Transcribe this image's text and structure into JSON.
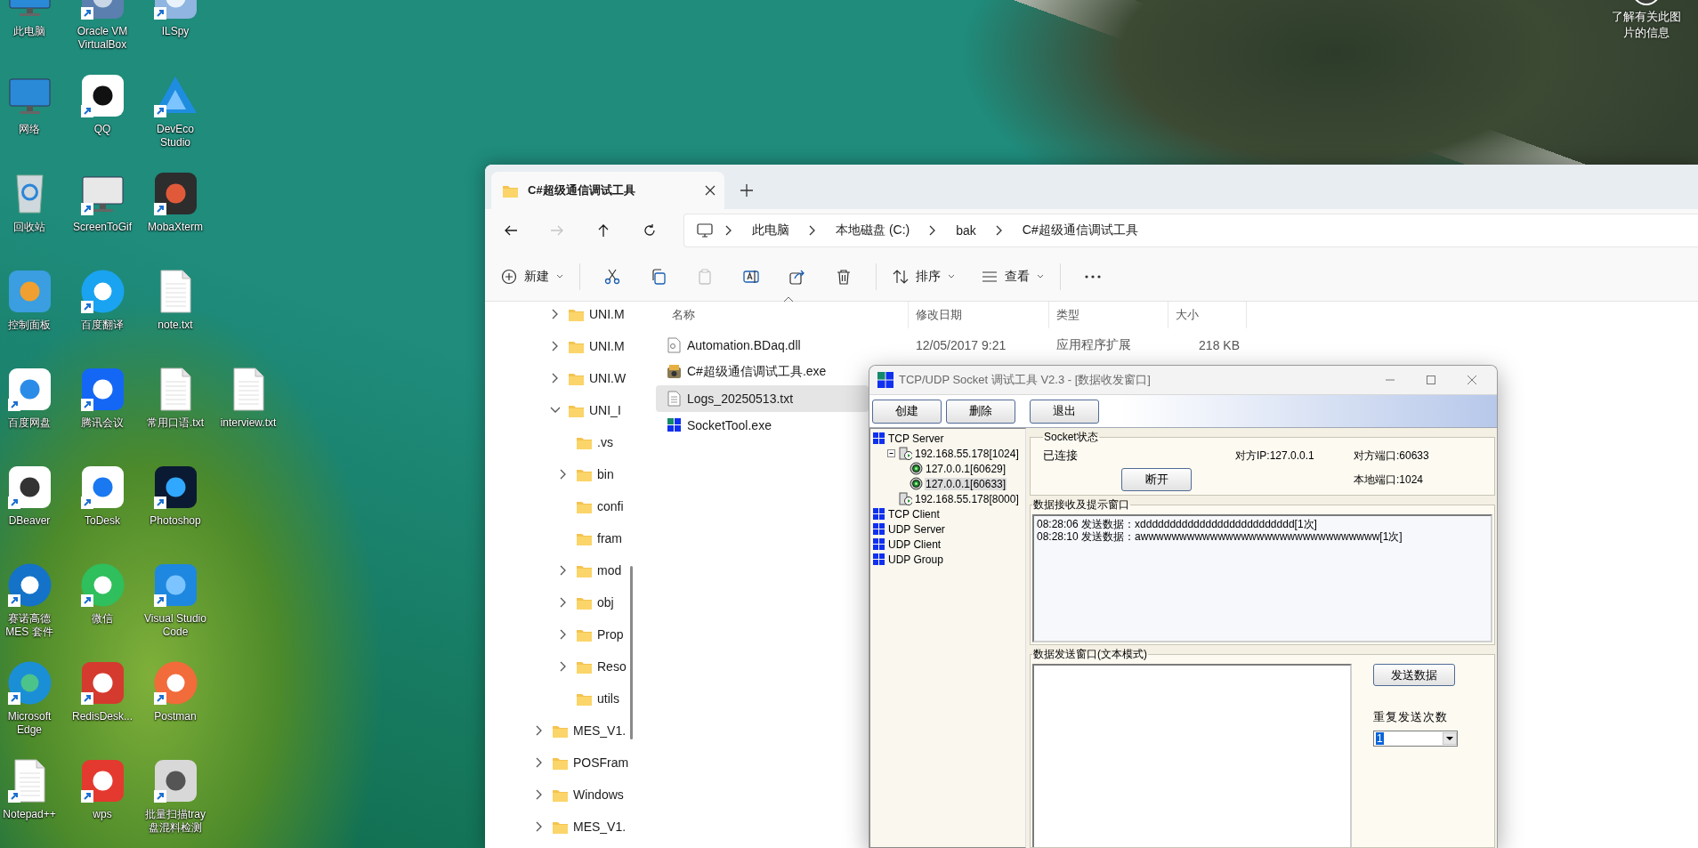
{
  "desktop": {
    "icon_rows": [
      [
        {
          "label": "此电脑",
          "shortcut": false
        },
        {
          "label": "Oracle VM VirtualBox",
          "shortcut": true
        },
        {
          "label": "ILSpy",
          "shortcut": true
        }
      ],
      [
        {
          "label": "网络",
          "shortcut": false
        },
        {
          "label": "QQ",
          "shortcut": true
        },
        {
          "label": "DevEco Studio",
          "shortcut": true
        }
      ],
      [
        {
          "label": "回收站",
          "shortcut": false
        },
        {
          "label": "ScreenToGif",
          "shortcut": true
        },
        {
          "label": "MobaXterm",
          "shortcut": true
        }
      ],
      [
        {
          "label": "控制面板",
          "shortcut": false
        },
        {
          "label": "百度翻译",
          "shortcut": true
        },
        {
          "label": "note.txt",
          "shortcut": false
        }
      ],
      [
        {
          "label": "百度网盘",
          "shortcut": true
        },
        {
          "label": "腾讯会议",
          "shortcut": true
        },
        {
          "label": "常用口语.txt",
          "shortcut": false
        },
        {
          "label": "interview.txt",
          "shortcut": false
        }
      ],
      [
        {
          "label": "DBeaver",
          "shortcut": true
        },
        {
          "label": "ToDesk",
          "shortcut": true
        },
        {
          "label": "Photoshop",
          "shortcut": true
        }
      ],
      [
        {
          "label": "赛诺高德 MES 套件",
          "shortcut": true
        },
        {
          "label": "微信",
          "shortcut": true
        },
        {
          "label": "Visual Studio Code",
          "shortcut": true
        }
      ],
      [
        {
          "label": "Microsoft Edge",
          "shortcut": true
        },
        {
          "label": "RedisDesk...",
          "shortcut": true
        },
        {
          "label": "Postman",
          "shortcut": true
        }
      ],
      [
        {
          "label": "Notepad++",
          "shortcut": true
        },
        {
          "label": "wps",
          "shortcut": true
        },
        {
          "label": "批量扫描tray盘混料检测",
          "shortcut": true
        }
      ]
    ],
    "image_info": {
      "label": "了解有关此图片的信息"
    }
  },
  "explorer": {
    "tab": {
      "title": "C#超级通信调试工具"
    },
    "nav_buttons": [
      {
        "disabled": false
      },
      {
        "disabled": true
      },
      {
        "disabled": false
      },
      {
        "disabled": false
      }
    ],
    "breadcrumbs": [
      "此电脑",
      "本地磁盘 (C:)",
      "bak",
      "C#超级通信调试工具"
    ],
    "toolbar": {
      "new_label": "新建",
      "icon_buttons": [
        {
          "disabled": false
        },
        {
          "disabled": false
        },
        {
          "disabled": true
        },
        {
          "disabled": false
        },
        {
          "disabled": false
        },
        {
          "disabled": false
        }
      ],
      "sort_label": "排序",
      "view_label": "查看"
    },
    "nav_tree": {
      "upper": [
        {
          "label": "UNI.M",
          "expanded": false
        },
        {
          "label": "UNI.M",
          "expanded": false
        },
        {
          "label": "UNI.W",
          "expanded": false
        },
        {
          "label": "UNI_I",
          "expanded": true,
          "children": [
            {
              "label": ".vs"
            },
            {
              "label": "bin",
              "expanded": false
            },
            {
              "label": "confi"
            },
            {
              "label": "fram"
            },
            {
              "label": "mod",
              "expanded": false
            },
            {
              "label": "obj",
              "expanded": false
            },
            {
              "label": "Prop",
              "expanded": false
            },
            {
              "label": "Reso",
              "expanded": false
            },
            {
              "label": "utils"
            }
          ]
        }
      ],
      "lower": [
        {
          "label": "MES_V1.",
          "expanded": false
        },
        {
          "label": "POSFram",
          "expanded": false
        },
        {
          "label": "Windows",
          "expanded": false
        },
        {
          "label": "MES_V1.",
          "expanded": false
        }
      ]
    },
    "columns": [
      "名称",
      "修改日期",
      "类型",
      "大小"
    ],
    "files": [
      {
        "name": "Automation.BDaq.dll",
        "modified": "12/05/2017 9:21",
        "type": "应用程序扩展",
        "size": "218 KB",
        "selected": false
      },
      {
        "name": "C#超级通信调试工具.exe",
        "selected": false
      },
      {
        "name": "Logs_20250513.txt",
        "selected": true
      },
      {
        "name": "SocketTool.exe",
        "selected": false
      }
    ]
  },
  "socket_tool": {
    "title": "TCP/UDP Socket 调试工具 V2.3 - [数据收发窗口]",
    "buttons": [
      "创建",
      "删除",
      "退出"
    ],
    "tree": [
      {
        "label": "TCP Server",
        "kind": "group",
        "selected": false,
        "children": [
          {
            "label": "192.168.55.178[1024]",
            "kind": "server",
            "expanded": true,
            "selected": false,
            "children": [
              {
                "label": "127.0.0.1[60629]",
                "kind": "client",
                "selected": false
              },
              {
                "label": "127.0.0.1[60633]",
                "kind": "client",
                "selected": true
              }
            ]
          },
          {
            "label": "192.168.55.178[8000]",
            "kind": "server",
            "selected": false
          }
        ]
      },
      {
        "label": "TCP Client",
        "kind": "group",
        "selected": false
      },
      {
        "label": "UDP Server",
        "kind": "group",
        "selected": false
      },
      {
        "label": "UDP Client",
        "kind": "group",
        "selected": false
      },
      {
        "label": "UDP Group",
        "kind": "group",
        "selected": false
      }
    ],
    "status": {
      "title": "Socket状态",
      "state": "已连接",
      "remote_ip": "对方IP:127.0.0.1",
      "remote_port": "对方端口:60633",
      "disconnect_button": "断开",
      "local_port": "本地端口:1024"
    },
    "receive": {
      "title": "数据接收及提示窗口",
      "lines": [
        "08:28:06 发送数据：xdddddddddddddddddddddddddd[1次]",
        "08:28:10 发送数据：awwwwwwwwwwwwwwwwwwwwwwwwwwwwwww[1次]"
      ]
    },
    "send": {
      "title": "数据发送窗口(文本模式)",
      "send_button": "发送数据",
      "repeat_label": "重复发送次数",
      "repeat_value": "1"
    }
  }
}
